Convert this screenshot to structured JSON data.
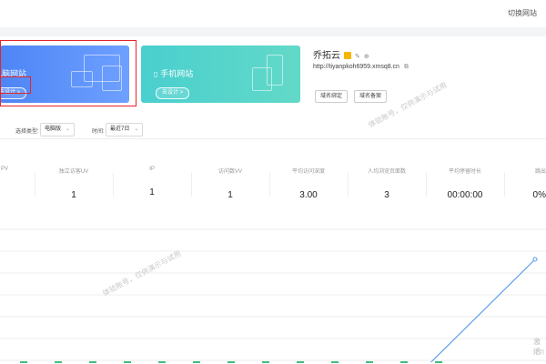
{
  "topbar": {
    "switch_site": "切换网站"
  },
  "cards": {
    "pc": {
      "title": "电脑网站",
      "button": "去设计 >"
    },
    "mobile": {
      "title": "手机网站",
      "button": "去设计 >",
      "icon": "phone-icon"
    }
  },
  "site": {
    "name": "乔拓云",
    "url": "http://tiyanpkoh6959.xmsq8.cn",
    "link_domain": "域名绑定",
    "link_record": "域名备案"
  },
  "filters": {
    "type_label": "选择类型:",
    "type_value": "电脑版",
    "time_label": "时间:",
    "time_value": "最近7日"
  },
  "stats": [
    {
      "label": "PV",
      "value": ""
    },
    {
      "label": "独立访客UV",
      "value": "1"
    },
    {
      "label": "IP",
      "value": "1"
    },
    {
      "label": "访问数VV",
      "value": "1"
    },
    {
      "label": "平均访问深度",
      "value": "3.00"
    },
    {
      "label": "人均浏览页面数",
      "value": "3"
    },
    {
      "label": "平均停留时长",
      "value": "00:00:00"
    },
    {
      "label": "跳出",
      "value": "0%"
    }
  ],
  "watermark": "体验账号，仅供演示与试用",
  "activate": {
    "title": "激活",
    "sub": "转到"
  },
  "chart_data": {
    "type": "line",
    "series": [
      {
        "values": [
          0,
          0,
          0,
          0,
          0,
          0,
          1
        ]
      }
    ],
    "x": [
      0,
      1,
      2,
      3,
      4,
      5,
      6
    ],
    "ylim": [
      0,
      1
    ],
    "color": "#5b9bea"
  }
}
